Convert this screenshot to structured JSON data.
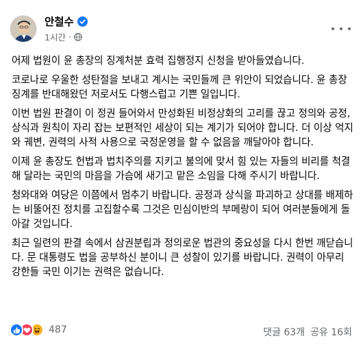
{
  "post": {
    "author": "안철수",
    "time": "1시간",
    "separator": "·",
    "verified": true,
    "audience_icon": "globe-icon",
    "paragraphs": [
      "어제 법원이 윤 총장의 징계처분 효력 집행정지 신청을 받아들였습니다.",
      "코로나로 우울한 성탄절을 보내고 계시는 국민들께 큰 위안이 되었습니다. 윤 총장 징계를 반대해왔던 저로서도 다행스럽고 기쁜 일입니다.",
      "이번 법원 판결이 이 정권 들어와서 만성화된 비정상화의 고리를 끊고 정의와 공정, 상식과 원칙이 자리 잡는 보편적인 세상이 되는 계기가 되어야 합니다. 더 이상 억지와 궤변, 권력의 사적 사용으로 국정운영을 할 수 없음을 깨달아야 합니다.",
      "이제 윤 총장도 헌법과 법치주의를 지키고 불의에 맞서 힘 있는 자들의 비리를 척결해 달라는 국민의 마음을 가슴에 새기고 맡은 소임을 다해 주시기 바랍니다.",
      "청와대와 여당은 이쯤에서 멈추기 바랍니다. 공정과 상식을 파괴하고 상대를 배제하는 비뚤어진 정치를 고집할수록 그것은 민심이반의 부메랑이 되어 여러분들에게 돌아갈 것입니다.",
      "최근 일련의 판결 속에서 삼권분립과 정의로운 법관의 중요성을 다시 한번 깨닫습니다. 문 대통령도 법을 공부하신 분이니 큰 성찰이 있기를 바랍니다. 권력이 아무리 강한들 국민 이기는 권력은 없습니다."
    ]
  },
  "footer": {
    "reaction_count": "487",
    "reactions": [
      "like-icon",
      "love-icon",
      "haha-icon"
    ],
    "comments": "댓글 63개",
    "shares": "공유 16회"
  },
  "colors": {
    "like": "#1877f2",
    "love": "#f33e58",
    "haha": "#f7b125",
    "verified": "#1877f2",
    "secondary_text": "#65676b"
  }
}
